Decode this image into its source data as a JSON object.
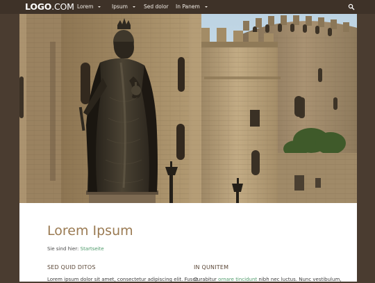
{
  "header": {
    "logo_bold": "LOGO",
    "logo_thin": ".COM",
    "nav": [
      {
        "label": "Lorem",
        "has_dropdown": true
      },
      {
        "label": "Ipsum",
        "has_dropdown": true
      },
      {
        "label": "Sed dolor",
        "has_dropdown": false
      },
      {
        "label": "In Panem",
        "has_dropdown": true
      }
    ],
    "search_icon": "search-icon"
  },
  "main": {
    "title": "Lorem Ipsum",
    "breadcrumb_prefix": "Sie sind hier: ",
    "breadcrumb_link": "Startseite",
    "columns": [
      {
        "title": "SED QUID DITOS",
        "text": "Lorem ipsum dolor sit amet, consectetur adipiscing elit. Fusce"
      },
      {
        "title": "IN QUNITEM",
        "text_before": "Curabitur ",
        "link": "ornare tincidunt",
        "text_after": " nibh nec luctus. Nunc vestibulum,"
      }
    ]
  },
  "colors": {
    "page_background": "#4a3c30",
    "topbar": "#3e3228",
    "title": "#9a7a52",
    "link": "#4e9a6a"
  }
}
